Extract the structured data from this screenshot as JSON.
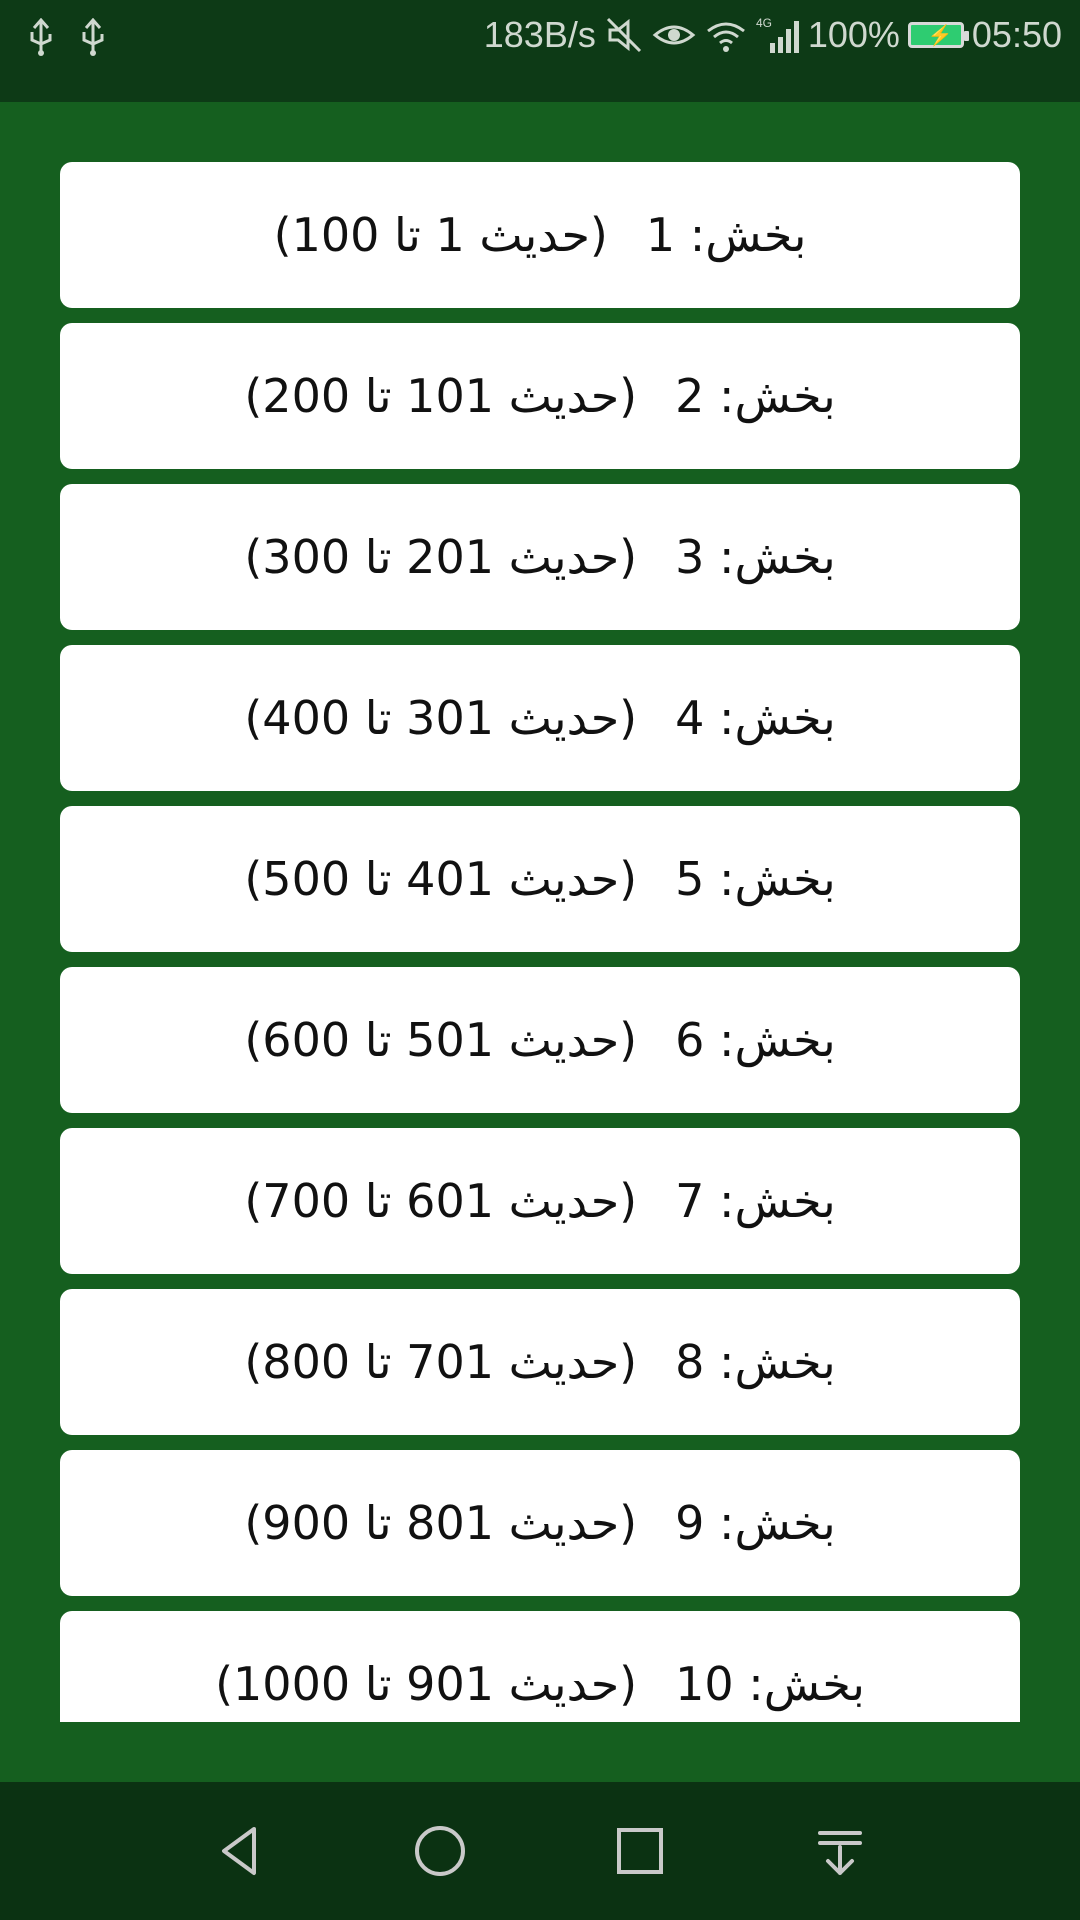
{
  "status_bar": {
    "speed": "183B/s",
    "battery_text": "100%",
    "time": "05:50",
    "network": "4G",
    "icons": [
      "usb-icon",
      "usb-icon",
      "mute-icon",
      "eye-icon",
      "wifi-icon",
      "signal-icon",
      "battery-icon"
    ]
  },
  "sections": [
    {
      "label": "بخش: 1",
      "range": "(حدیث 1 تا 100)"
    },
    {
      "label": "بخش: 2",
      "range": "(حدیث 101 تا 200)"
    },
    {
      "label": "بخش: 3",
      "range": "(حدیث 201 تا 300)"
    },
    {
      "label": "بخش: 4",
      "range": "(حدیث 301 تا 400)"
    },
    {
      "label": "بخش: 5",
      "range": "(حدیث 401 تا 500)"
    },
    {
      "label": "بخش: 6",
      "range": "(حدیث 501 تا 600)"
    },
    {
      "label": "بخش: 7",
      "range": "(حدیث 601 تا 700)"
    },
    {
      "label": "بخش: 8",
      "range": "(حدیث 701 تا 800)"
    },
    {
      "label": "بخش: 9",
      "range": "(حدیث 801 تا 900)"
    },
    {
      "label": "بخش: 10",
      "range": "(حدیث 901 تا 1000)"
    }
  ],
  "nav": {
    "buttons": [
      "back-icon",
      "home-icon",
      "recents-icon",
      "notifications-down-icon"
    ]
  },
  "colors": {
    "background": "#155f1f",
    "status_bar": "#0d3a16",
    "card": "#ffffff"
  }
}
